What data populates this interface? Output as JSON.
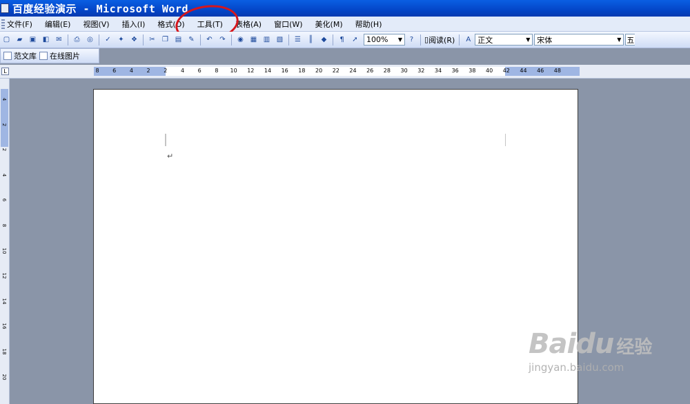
{
  "window": {
    "title": "百度经验演示 - Microsoft Word"
  },
  "menubar": {
    "items": [
      "文件(F)",
      "编辑(E)",
      "视图(V)",
      "插入(I)",
      "格式(O)",
      "工具(T)",
      "表格(A)",
      "窗口(W)",
      "美化(M)",
      "帮助(H)"
    ]
  },
  "toolbar": {
    "zoom": "100%",
    "read_label": "阅读(R)",
    "style": "正文",
    "font": "宋体",
    "size": "五"
  },
  "toolbar2": {
    "items": [
      "范文库",
      "在线图片"
    ]
  },
  "ruler": {
    "h_ticks": [
      "8",
      "6",
      "4",
      "2",
      "2",
      "4",
      "6",
      "8",
      "10",
      "12",
      "14",
      "16",
      "18",
      "20",
      "22",
      "24",
      "26",
      "28",
      "30",
      "32",
      "34",
      "36",
      "38",
      "40",
      "42",
      "44",
      "46",
      "48"
    ],
    "v_ticks": [
      "4",
      "2",
      "2",
      "4",
      "6",
      "8",
      "10",
      "12",
      "14",
      "16",
      "18",
      "20"
    ]
  },
  "document": {
    "paragraph_mark": "↵"
  },
  "watermark": {
    "brand": "Baidu",
    "brand_cn": "经验",
    "url": "jingyan.baidu.com"
  },
  "colors": {
    "titlebar": "#0a5fe3",
    "annotation": "#d6161c",
    "workspace": "#8a95a8"
  }
}
